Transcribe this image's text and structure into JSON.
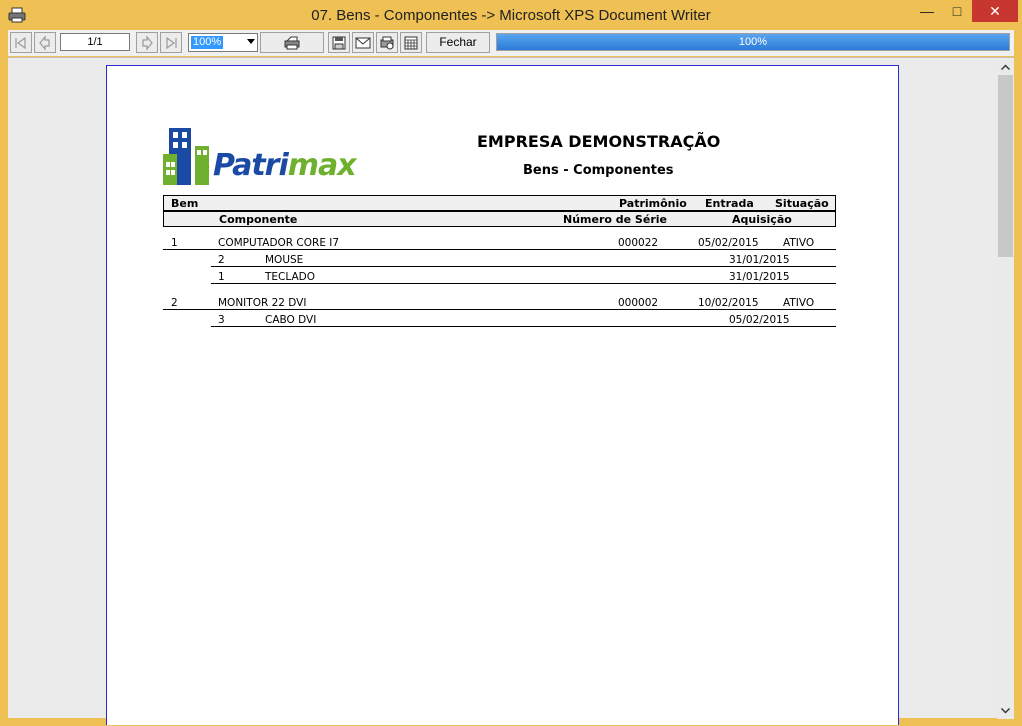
{
  "window": {
    "title": "07. Bens - Componentes -> Microsoft XPS Document Writer",
    "minimize": "—",
    "maximize": "□",
    "close": "✕"
  },
  "toolbar": {
    "page_indicator": "1/1",
    "zoom": "100%",
    "close_label": "Fechar",
    "progress_label": "100%",
    "progress_value": 1.0,
    "icons": [
      "first-page-icon",
      "prev-page-icon",
      "next-page-icon",
      "last-page-icon",
      "print-icon",
      "save-icon",
      "email-icon",
      "print-setup-icon",
      "calendar-icon"
    ]
  },
  "report": {
    "company": "EMPRESA DEMONSTRAÇÃO",
    "title": "Bens - Componentes",
    "logo_text_a": "Patri",
    "logo_text_b": "max",
    "header1": {
      "bem": "Bem",
      "patrimonio": "Patrimônio",
      "entrada": "Entrada",
      "situacao": "Situação"
    },
    "header2": {
      "componente": "Componente",
      "numero_serie": "Número de Série",
      "aquisicao": "Aquisição"
    },
    "items": [
      {
        "bem": "1",
        "descricao": "COMPUTADOR CORE I7",
        "patrimonio": "000022",
        "entrada": "05/02/2015",
        "situacao": "ATIVO",
        "componentes": [
          {
            "codigo": "2",
            "descricao": "MOUSE",
            "aquisicao": "31/01/2015"
          },
          {
            "codigo": "1",
            "descricao": "TECLADO",
            "aquisicao": "31/01/2015"
          }
        ]
      },
      {
        "bem": "2",
        "descricao": "MONITOR 22 DVI",
        "patrimonio": "000002",
        "entrada": "10/02/2015",
        "situacao": "ATIVO",
        "componentes": [
          {
            "codigo": "3",
            "descricao": "CABO DVI",
            "aquisicao": "05/02/2015"
          }
        ]
      }
    ]
  }
}
